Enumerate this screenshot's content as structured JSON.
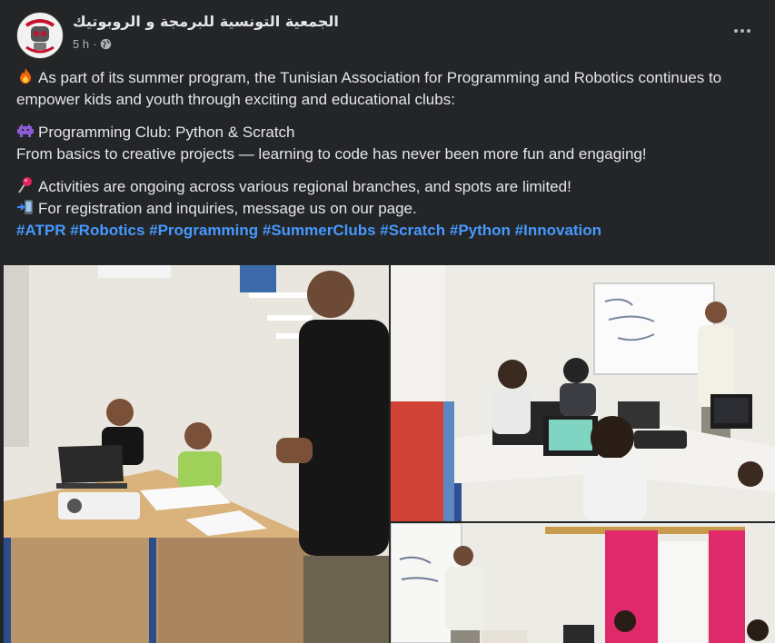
{
  "post": {
    "author": "الجمعية التونسية للبرمجة و الروبوتيك",
    "time": "5 h",
    "privacy_icon": "globe-icon",
    "more_icon": "more-options-icon",
    "paragraphs": {
      "p1": "As part of its summer program, the Tunisian Association for Programming and Robotics continues to empower kids and youth through exciting and educational clubs:",
      "p2a": "Programming Club: Python & Scratch",
      "p2b": "From basics to creative projects — learning to code has never been more fun and engaging!",
      "p3a": "Activities are ongoing across various regional branches, and spots are limited!",
      "p3b": "For registration and inquiries, message us on our page."
    },
    "emoji_icons": [
      "fire-icon",
      "alien-monster-icon",
      "round-pushpin-icon",
      "mobile-arrow-icon"
    ],
    "hashtags": [
      "#ATPR",
      "#Robotics",
      "#Programming",
      "#SummerClubs",
      "#Scratch",
      "#Python",
      "#Innovation"
    ],
    "photos": [
      "classroom-photo-1",
      "classroom-photo-2",
      "classroom-photo-3"
    ]
  },
  "colors": {
    "background": "#242526",
    "text": "#e4e6eb",
    "secondary_text": "#b0b3b8",
    "hashtag": "#4599ff"
  }
}
